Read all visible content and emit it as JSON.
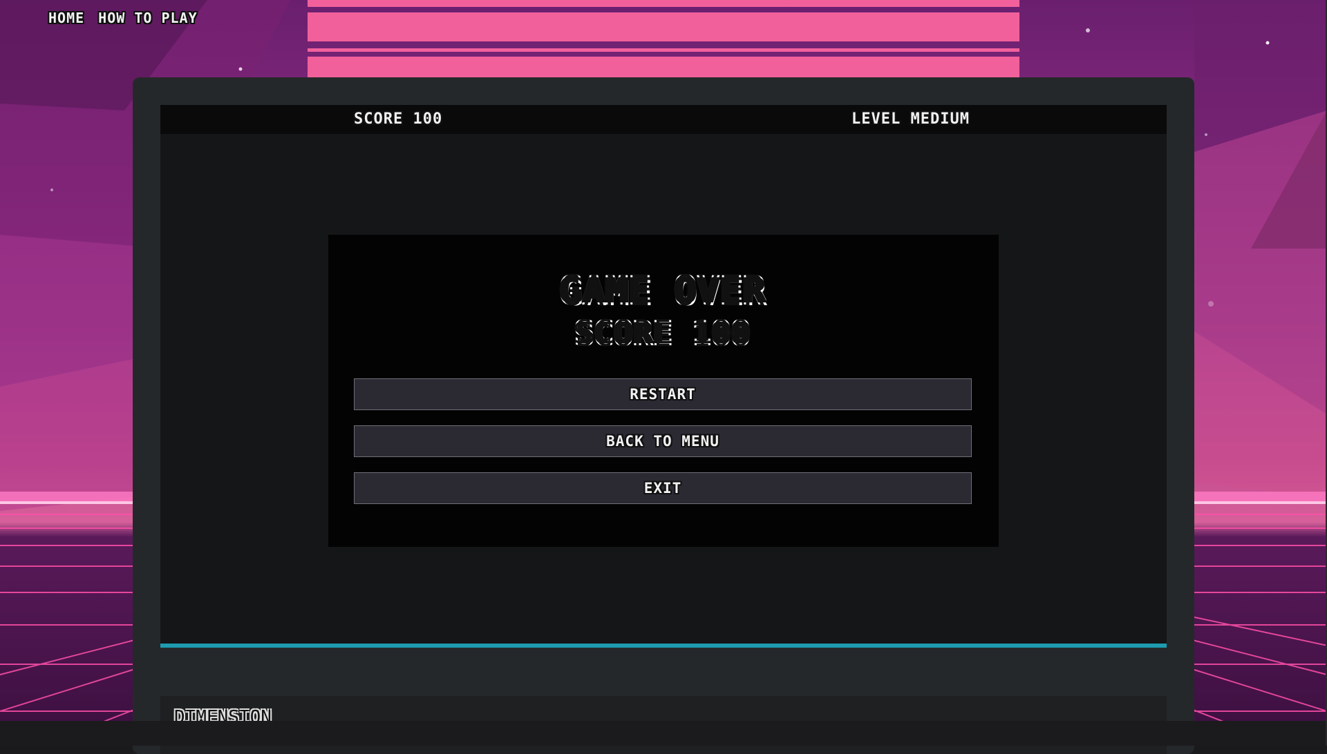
{
  "nav": {
    "home": "HOME",
    "how_to_play": "HOW TO PLAY"
  },
  "hud": {
    "score": "SCORE 100",
    "level": "LEVEL MEDIUM"
  },
  "modal": {
    "title": "GAME OVER",
    "final_score": "SCORE 100",
    "buttons": {
      "restart": "RESTART",
      "back_to_menu": "BACK TO MENU",
      "exit": "EXIT"
    }
  },
  "panel": {
    "title": "DIMENSION"
  },
  "colors": {
    "accent_line": "#1e9bb0",
    "sun": "#f2609c",
    "grid": "#ff4fa8",
    "frame": "#25282a",
    "game_bg": "#141617",
    "modal_bg": "#030303",
    "button_bg": "#2b2a33"
  }
}
